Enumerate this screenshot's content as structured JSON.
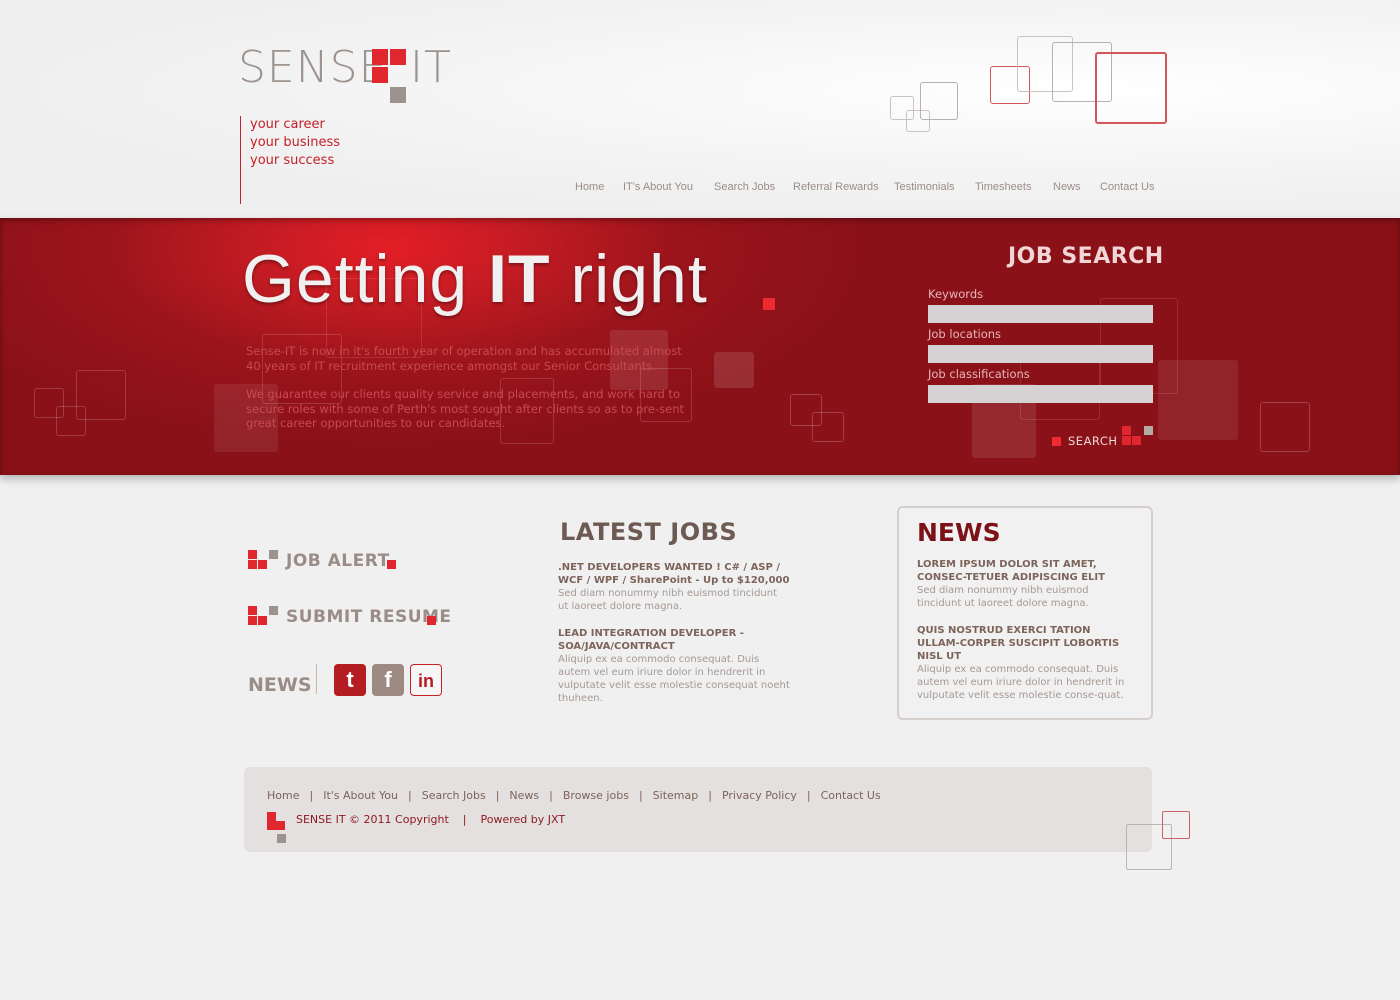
{
  "brand": {
    "name_left": "SENSE",
    "name_right": "IT",
    "accent": "#e0262e",
    "dark_red": "#8a1118",
    "grey": "#9c938e"
  },
  "tagline": [
    "your career",
    "your business",
    "your success"
  ],
  "nav": [
    "Home",
    "IT's About You",
    "Search Jobs",
    "Referral Rewards",
    "Testimonials",
    "Timesheets",
    "News",
    "Contact Us"
  ],
  "hero": {
    "headline_a": "Getting ",
    "headline_b": "IT",
    "headline_c": " right",
    "intro_1": "Sense-IT is now in it's fourth year of operation and has accumulated almost 40 years of IT recruitment experience amongst our Senior Consultants.",
    "intro_2": "We guarantee our clients quality service and placements, and work hard to secure roles with some of Perth's most sought after clients so as to pre-sent great career opportunities to our candidates."
  },
  "job_search": {
    "title": "JOB SEARCH",
    "keywords_label": "Keywords",
    "locations_label": "Job locations",
    "classifications_label": "Job classifications",
    "keywords_value": "",
    "locations_value": "",
    "classifications_value": "",
    "search_label": "SEARCH"
  },
  "sidebar": {
    "job_alert": "JOB ALERT",
    "submit_resume": "SUBMIT RESUME",
    "news": "NEWS",
    "social": [
      {
        "icon": "twitter-icon",
        "glyph": "t"
      },
      {
        "icon": "facebook-icon",
        "glyph": "f"
      },
      {
        "icon": "linkedin-icon",
        "glyph": "in"
      }
    ]
  },
  "latest_jobs": {
    "title": "LATEST JOBS",
    "items": [
      {
        "title": ".NET DEVELOPERS WANTED ! C# / ASP / WCF / WPF / SharePoint - Up to $120,000",
        "desc": "Sed diam nonummy nibh euismod tincidunt ut laoreet dolore magna."
      },
      {
        "title": "LEAD INTEGRATION DEVELOPER - SOA/JAVA/CONTRACT",
        "desc": "Aliquip ex ea commodo consequat. Duis autem vel eum iriure dolor in hendrerit in vulputate velit esse molestie consequat noeht thuheen."
      }
    ]
  },
  "news_box": {
    "title": "NEWS",
    "items": [
      {
        "title": "LOREM IPSUM DOLOR SIT AMET, CONSEC-TETUER ADIPISCING ELIT",
        "desc": "Sed diam nonummy nibh euismod tincidunt ut laoreet dolore magna."
      },
      {
        "title": "QUIS NOSTRUD EXERCI TATION ULLAM-CORPER SUSCIPIT LOBORTIS NISL UT",
        "desc": "Aliquip ex ea commodo consequat. Duis autem vel eum iriure dolor in hendrerit in vulputate velit esse molestie conse-quat."
      }
    ]
  },
  "footer": {
    "links": [
      "Home",
      "It's About You",
      "Search Jobs",
      "News",
      "Browse jobs",
      "Sitemap",
      "Privacy Policy",
      "Contact Us"
    ],
    "separator": "|",
    "copyright": "SENSE IT © 2011 Copyright",
    "powered": "Powered by JXT"
  }
}
